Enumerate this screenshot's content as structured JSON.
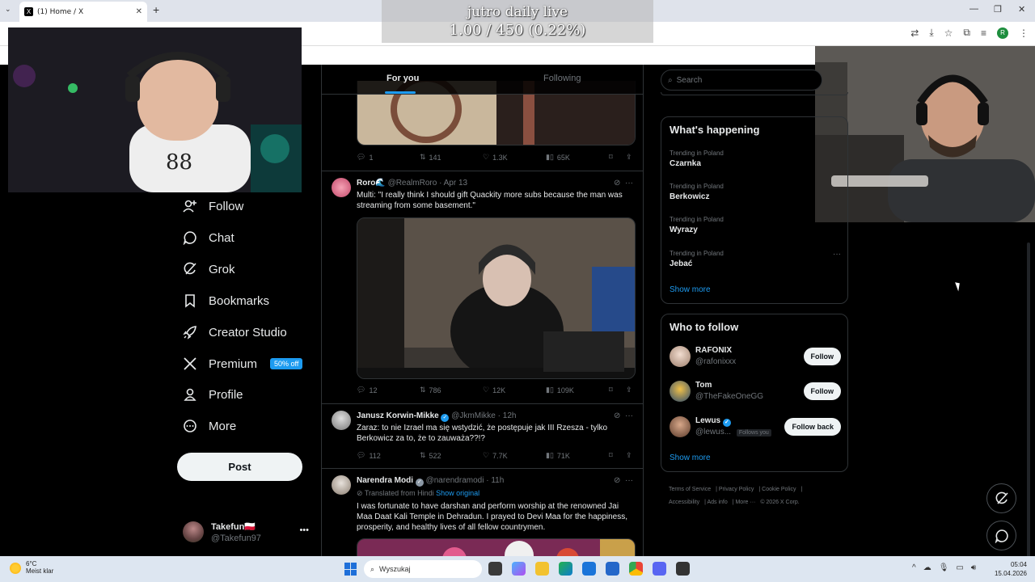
{
  "browser": {
    "tab_title": "(1) Home / X",
    "tab_close": "✕",
    "new_tab": "+",
    "profile_initial": "R"
  },
  "overlay": {
    "line1": "jutro daily live",
    "line2": "1.00 / 450 (0.22%)",
    "progress_fraction": 0.0022
  },
  "nav": {
    "items": [
      {
        "label": "Follow",
        "icon": "person-plus-icon"
      },
      {
        "label": "Chat",
        "icon": "chat-bubble-icon"
      },
      {
        "label": "Grok",
        "icon": "grok-icon"
      },
      {
        "label": "Bookmarks",
        "icon": "bookmark-icon"
      },
      {
        "label": "Creator Studio",
        "icon": "rocket-icon"
      },
      {
        "label": "Premium",
        "icon": "x-logo-icon",
        "badge": "50% off"
      },
      {
        "label": "Profile",
        "icon": "person-icon"
      },
      {
        "label": "More",
        "icon": "more-circle-icon"
      }
    ],
    "post_label": "Post",
    "account": {
      "name": "Takefun🇵🇱",
      "handle": "@Takefun97",
      "more": "•••"
    }
  },
  "timeline": {
    "tabs": [
      {
        "label": "For you",
        "active": true
      },
      {
        "label": "Following",
        "active": false
      }
    ],
    "first_actions": {
      "reply": "1",
      "repost": "141",
      "like": "1.3K",
      "views": "65K"
    },
    "tweets": [
      {
        "name": "Roro🌊",
        "handle": "@RealmRoro",
        "time": "Apr 13",
        "verified": false,
        "text": "Multi: \"I really think I should gift Quackity more subs because the man was streaming from some basement.\"",
        "actions": {
          "reply": "12",
          "repost": "786",
          "like": "12K",
          "views": "109K"
        }
      },
      {
        "name": "Janusz Korwin-Mikke",
        "handle": "@JkmMikke",
        "time": "12h",
        "verified": true,
        "text": "Zaraz: to nie Izrael ma się wstydzić, że postępuje jak III Rzesza - tylko Berkowicz za to, że to zauważa??!?",
        "actions": {
          "reply": "112",
          "repost": "522",
          "like": "7.7K",
          "views": "71K"
        }
      },
      {
        "name": "Narendra Modi",
        "handle": "@narendramodi",
        "time": "11h",
        "verified": true,
        "translated": "Translated from Hindi",
        "show_original": "Show original",
        "text": "I was fortunate to have darshan and perform worship at the renowned Jai Maa Daat Kali Temple in Dehradun. I prayed to Devi Maa for the happiness, prosperity, and healthy lives of all fellow countrymen."
      }
    ]
  },
  "right": {
    "search_placeholder": "Search",
    "whats_happening": "What's happening",
    "trends": [
      {
        "context": "Trending in Poland",
        "topic": "Czarnka"
      },
      {
        "context": "Trending in Poland",
        "topic": "Berkowicz"
      },
      {
        "context": "Trending in Poland",
        "topic": "Wyrazy"
      },
      {
        "context": "Trending in Poland",
        "topic": "Jebać"
      }
    ],
    "show_more": "Show more",
    "who_to_follow": "Who to follow",
    "follow_suggestions": [
      {
        "name": "RAFONIX",
        "handle": "@rafonixxx",
        "button": "Follow",
        "verified": false
      },
      {
        "name": "Tom",
        "handle": "@TheFakeOneGG",
        "button": "Follow",
        "verified": false
      },
      {
        "name": "Lewus",
        "handle": "@lewus...",
        "button": "Follow back",
        "verified": true,
        "follows_you": "Follows you"
      }
    ],
    "footer": [
      "Terms of Service",
      "Privacy Policy",
      "Cookie Policy",
      "Accessibility",
      "Ads info",
      "More ···",
      "© 2026 X Corp."
    ]
  },
  "taskbar": {
    "temp": "6°C",
    "weather": "Meist klar",
    "search": "Wyszukaj",
    "time": "05:04",
    "date": "15.04.2026"
  }
}
